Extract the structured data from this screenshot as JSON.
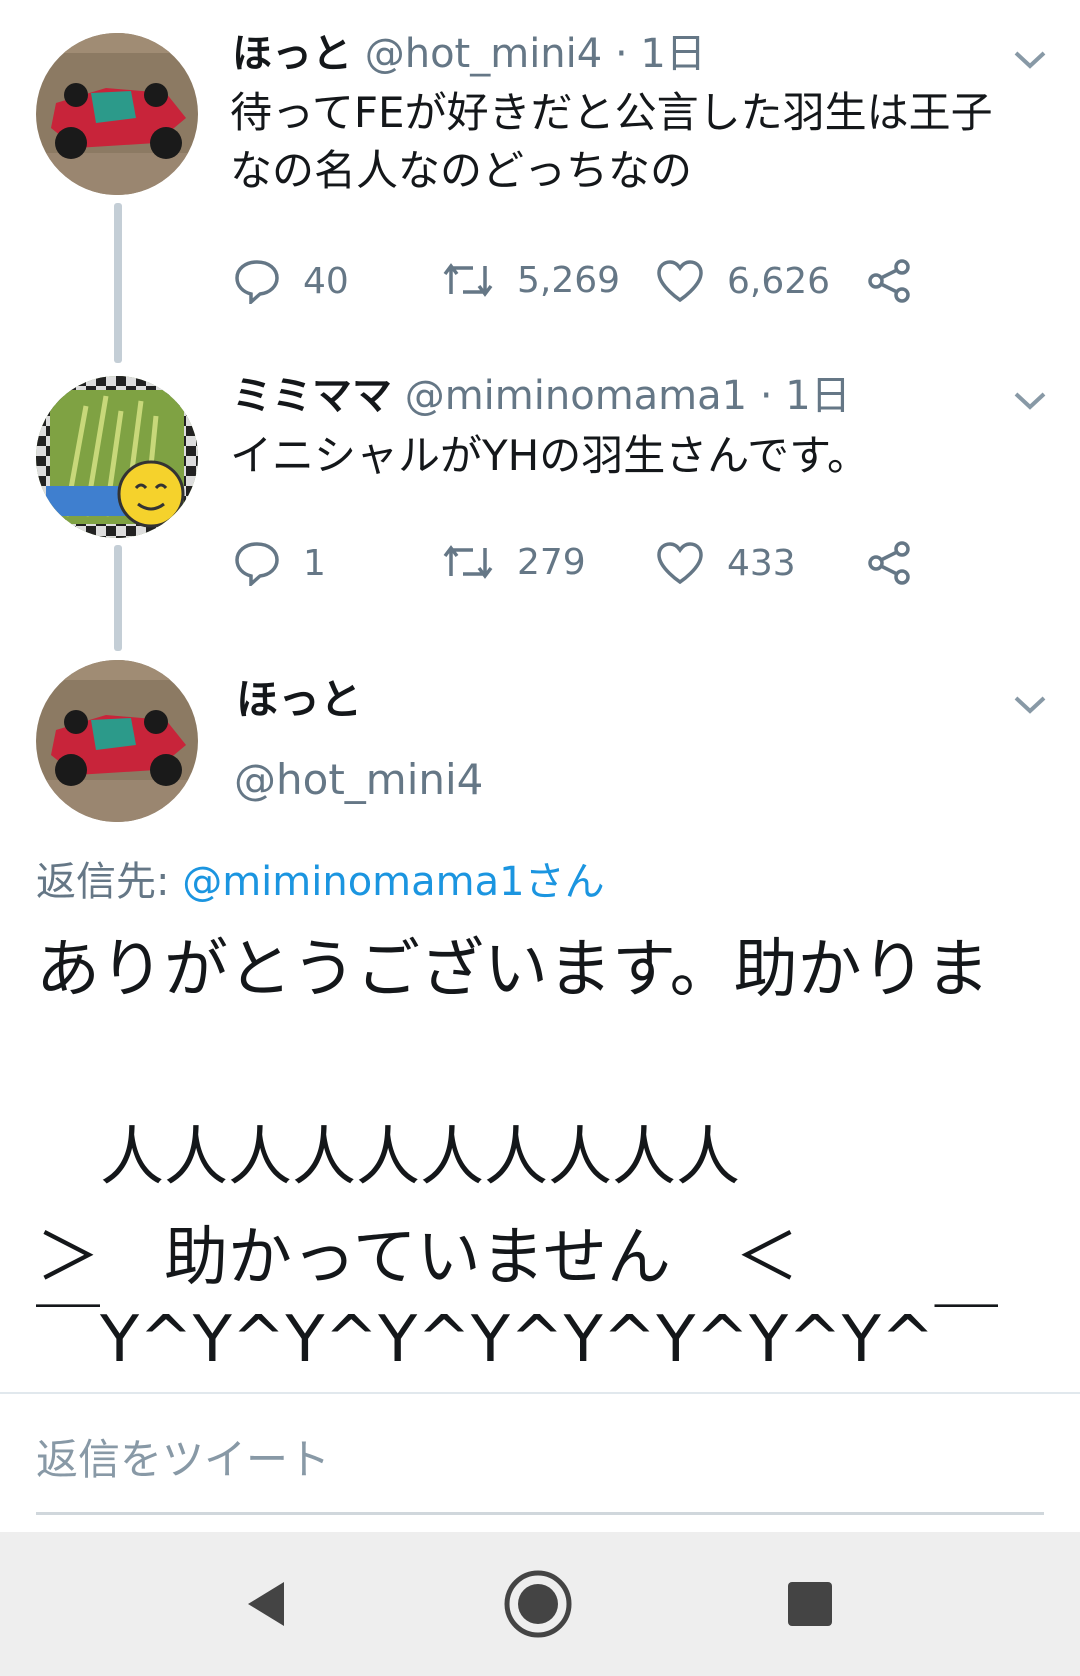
{
  "tweet1": {
    "display_name": "ほっと",
    "handle": "@hot_mini4",
    "time": "· 1日",
    "text_line1": "待ってFEが好きだと公言した羽生は王子",
    "text_line2": "なの名人なのどっちなの",
    "replies": "40",
    "retweets": "5,269",
    "likes": "6,626"
  },
  "tweet2": {
    "display_name": "ミミママ",
    "handle": "@miminomama1",
    "time": "· 1日",
    "text": "イニシャルがYHの羽生さんです。",
    "replies": "1",
    "retweets": "279",
    "likes": "433"
  },
  "main_tweet": {
    "display_name": "ほっと",
    "handle": "@hot_mini4",
    "reply_to_prefix": "返信先: ",
    "reply_to_handle": "@miminomama1さん",
    "line1": "ありがとうございます。助かりま",
    "line2": "　人人人人人人人人人人",
    "line3": "＞　助かっていません　＜",
    "line4": "￣Y^Y^Y^Y^Y^Y^Y^Y^Y^￣"
  },
  "reply_bar": {
    "placeholder": "返信をツイート"
  },
  "colors": {
    "link": "#1b95e0",
    "muted": "#657786",
    "thread_line": "#c4ced6",
    "nav_background": "#eeeeee"
  }
}
